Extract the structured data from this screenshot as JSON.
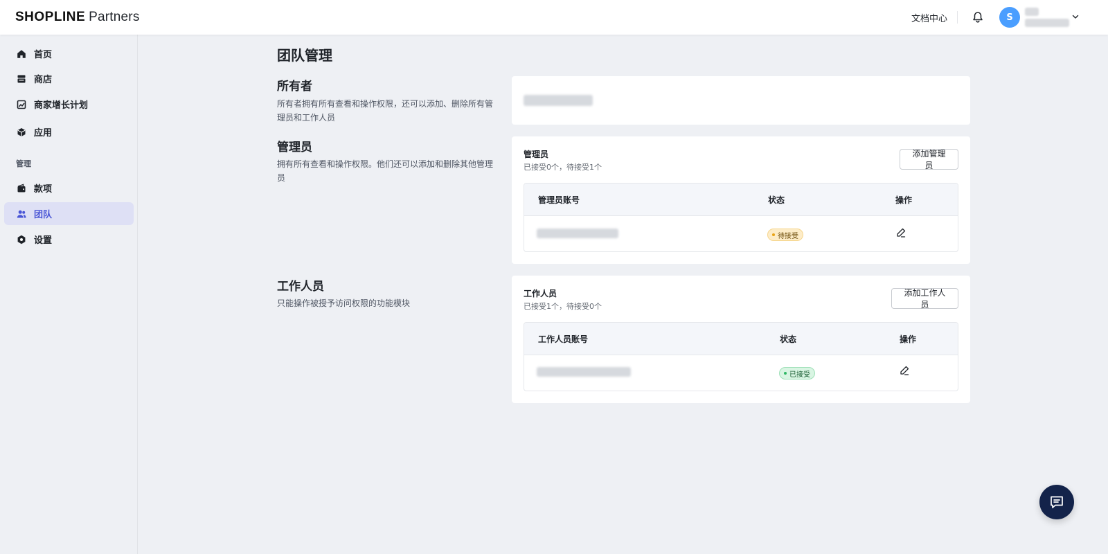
{
  "header": {
    "logo_brand": "SHOPLINE",
    "logo_suffix": "Partners",
    "doc_center": "文档中心",
    "avatar_initial": "S",
    "icons": {
      "notification": "bell-icon",
      "account_menu": "chevron-down-icon"
    }
  },
  "sidebar": {
    "items": [
      {
        "label": "首页",
        "icon": "home-icon"
      },
      {
        "label": "商店",
        "icon": "store-icon"
      },
      {
        "label": "商家增长计划",
        "icon": "growth-chart-icon"
      },
      {
        "label": "应用",
        "icon": "app-cube-icon"
      }
    ],
    "section_label": "管理",
    "manage_items": [
      {
        "label": "款项",
        "icon": "wallet-icon"
      },
      {
        "label": "团队",
        "icon": "team-icon",
        "active": true
      },
      {
        "label": "设置",
        "icon": "settings-icon"
      }
    ]
  },
  "main": {
    "page_title": "团队管理",
    "owner": {
      "title": "所有者",
      "desc": "所有者拥有所有查看和操作权限，还可以添加、删除所有管理员和工作人员"
    },
    "admins": {
      "title": "管理员",
      "desc": "拥有所有查看和操作权限。他们还可以添加和删除其他管理员",
      "card_title": "管理员",
      "card_sub": "已接受0个，待接受1个",
      "add_button": "添加管理员",
      "columns": [
        "管理员账号",
        "状态",
        "操作"
      ],
      "rows": [
        {
          "status": "待接受",
          "status_type": "pending"
        }
      ]
    },
    "staff": {
      "title": "工作人员",
      "desc": "只能操作被授予访问权限的功能模块",
      "card_title": "工作人员",
      "card_sub": "已接受1个，待接受0个",
      "add_button": "添加工作人员",
      "columns": [
        "工作人员账号",
        "状态",
        "操作"
      ],
      "rows": [
        {
          "status": "已接受",
          "status_type": "accepted"
        }
      ]
    }
  },
  "colors": {
    "accent": "#4955d6",
    "active_bg": "#dee0f5",
    "avatar": "#4a9eff",
    "chat_button": "#13234a",
    "pending_badge": "#fdecc8",
    "accepted_badge": "#d9f5e3"
  },
  "chat": {
    "icon": "chat-message-icon"
  }
}
